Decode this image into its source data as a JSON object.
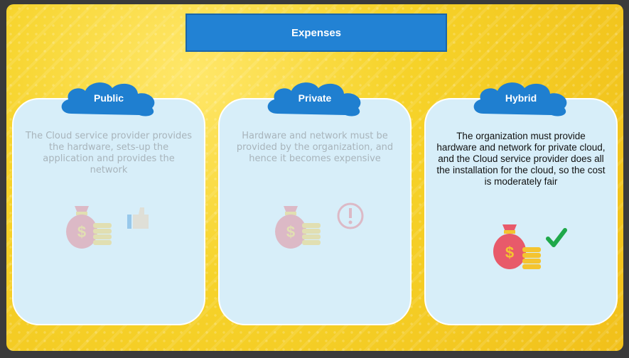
{
  "title": "Expenses",
  "cards": [
    {
      "heading": "Public",
      "text": "The Cloud service provider provides the hardware, sets-up the application and provides the network",
      "icons": [
        "money-bag-icon",
        "coins-icon",
        "thumbs-up-icon"
      ]
    },
    {
      "heading": "Private",
      "text": "Hardware and network must be provided by the organization, and hence it becomes expensive",
      "icons": [
        "money-bag-icon",
        "coins-icon",
        "exclamation-icon"
      ]
    },
    {
      "heading": "Hybrid",
      "text": "The organization must provide hardware and network for private cloud, and the Cloud service provider does all the installation for the cloud, so the cost is moderately fair",
      "icons": [
        "money-bag-icon",
        "coins-icon",
        "checkmark-icon"
      ]
    }
  ],
  "colors": {
    "title_bar": "#2282d4",
    "cloud": "#1f7fd0",
    "card_bg": "#d7eef9",
    "check": "#1fa84a",
    "bag": "#e85a6a",
    "coins": "#f4c430"
  }
}
